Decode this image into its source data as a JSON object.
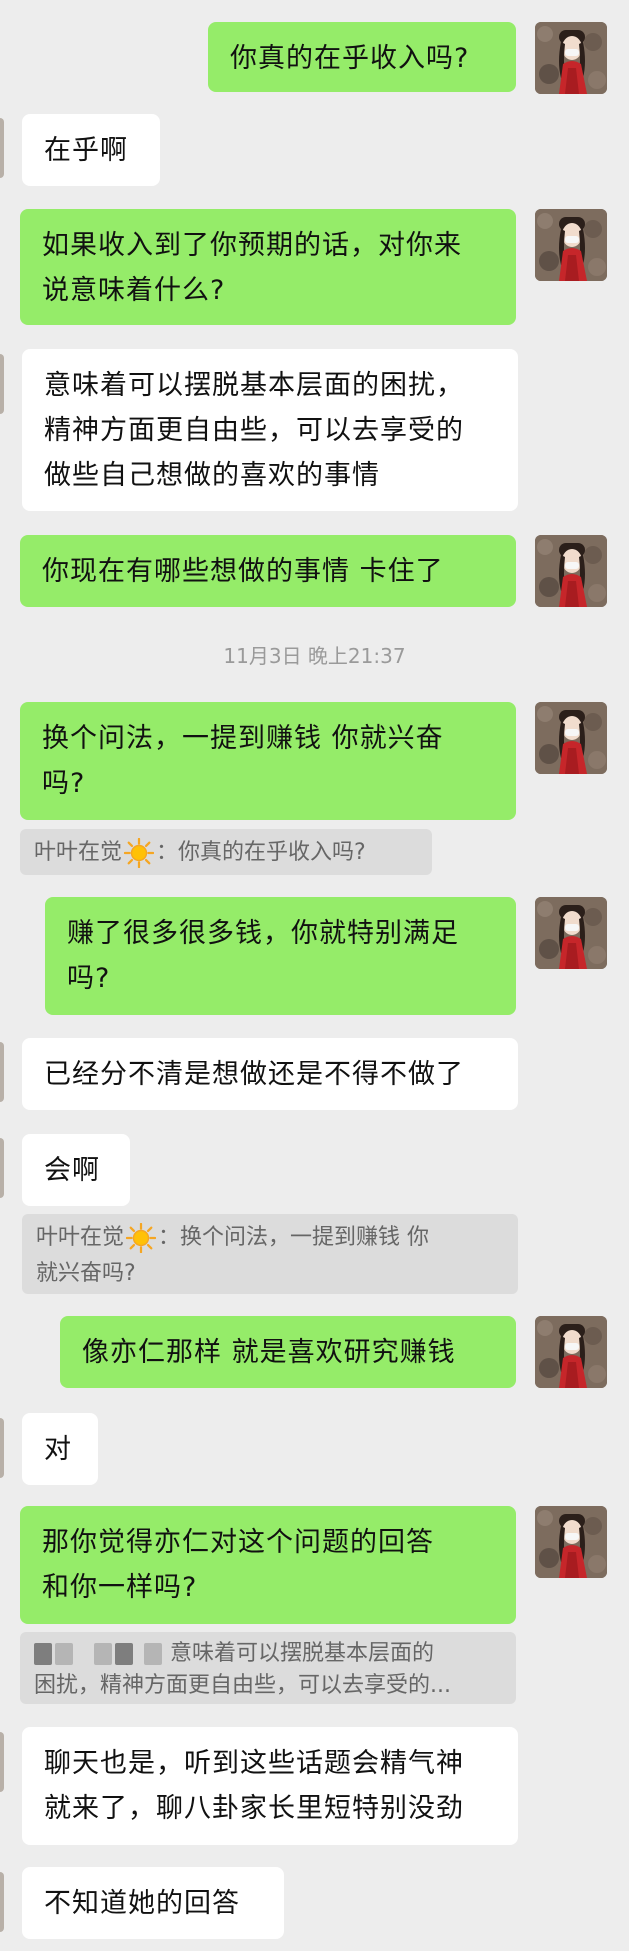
{
  "colors": {
    "self_bubble": "#95ec69",
    "other_bubble": "#ffffff",
    "background": "#ededed",
    "quote_bg": "#dcdcdc"
  },
  "messages": [
    {
      "text": "你真的在乎收入吗?"
    },
    {
      "text": "在乎啊"
    },
    {
      "text": "如果收入到了你预期的话，对你来\n说意味着什么?"
    },
    {
      "text": "意味着可以摆脱基本层面的困扰，\n精神方面更自由些，可以去享受的\n做些自己想做的喜欢的事情"
    },
    {
      "text": "你现在有哪些想做的事情 卡住了"
    },
    {
      "text": "换个问法，一提到赚钱 你就兴奋\n吗?"
    },
    {
      "text": "赚了很多很多钱，你就特别满足\n吗?"
    },
    {
      "text": "已经分不清是想做还是不得不做了"
    },
    {
      "text": "会啊"
    },
    {
      "text": "像亦仁那样 就是喜欢研究赚钱"
    },
    {
      "text": "对"
    },
    {
      "text": "那你觉得亦仁对这个问题的回答\n和你一样吗?"
    },
    {
      "text": "聊天也是，听到这些话题会精气神\n就来了，聊八卦家长里短特别没劲"
    },
    {
      "text": "不知道她的回答"
    }
  ],
  "timestamp": "11月3日 晚上21:37",
  "quotes": [
    {
      "sender": "叶叶在觉",
      "text": "：你真的在乎收入吗?"
    },
    {
      "sender": "叶叶在觉",
      "text": "：换个问法，一提到赚钱 你",
      "text2": "就兴奋吗?"
    },
    {
      "text": "意味着可以摆脱基本层面的",
      "text2": "困扰，精神方面更自由些，可以去享受的..."
    }
  ],
  "icons": {
    "sun": "sun-emoji-icon",
    "avatar": "avatar-icon"
  }
}
